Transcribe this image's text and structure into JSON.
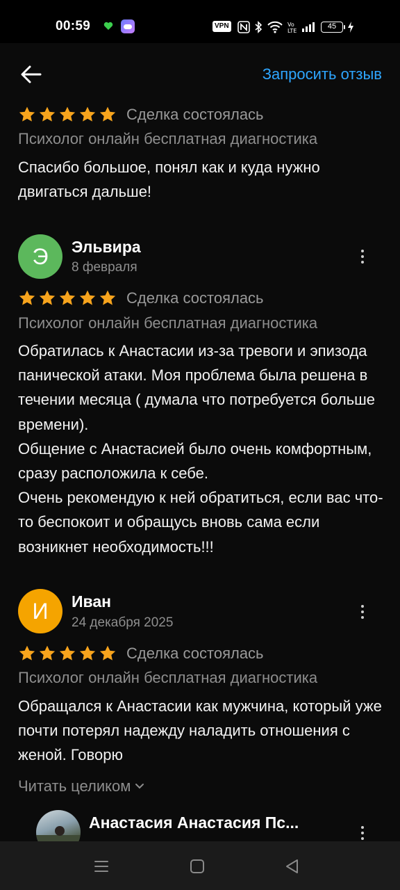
{
  "status_bar": {
    "time": "00:59",
    "vpn": "VPN",
    "battery": "45"
  },
  "header": {
    "request_review": "Запросить отзыв"
  },
  "colors": {
    "accent": "#2ea6ff",
    "star": "#f7a41d",
    "avatar_green": "#5cb85c",
    "avatar_orange": "#f5a400"
  },
  "reviews": [
    {
      "rating": 5,
      "deal_status": "Сделка состоялась",
      "service": "Психолог онлайн бесплатная диагностика",
      "text": "Спасибо большое, понял как и куда нужно двигаться дальше!"
    },
    {
      "author": "Эльвира",
      "initial": "Э",
      "date": "8 февраля",
      "rating": 5,
      "deal_status": "Сделка состоялась",
      "service": "Психолог онлайн бесплатная диагностика",
      "text": "Обратилась к Анастасии из-за тревоги и эпизода панической атаки. Моя проблема была решена в течении месяца ( думала что потребуется больше времени).\nОбщение с Анастасией было очень комфортным, сразу расположила к себе.\nОчень рекомендую к ней обратиться, если вас что-то беспокоит и обращусь вновь сама если возникнет необходимость!!!"
    },
    {
      "author": "Иван",
      "initial": "И",
      "date": "24 декабря 2025",
      "rating": 5,
      "deal_status": "Сделка состоялась",
      "service": "Психолог онлайн бесплатная диагностика",
      "text": "Обращался к Анастасии как мужчина, который уже почти потерял надежду наладить отношения с женой. Говорю",
      "read_more": "Читать целиком"
    }
  ],
  "reply": {
    "author": "Анастасия Анастасия Пс..."
  },
  "icons": [
    "back-arrow-icon",
    "star-icon",
    "more-vertical-icon",
    "chevron-down-icon",
    "menu-icon",
    "home-icon",
    "back-triangle-icon"
  ]
}
